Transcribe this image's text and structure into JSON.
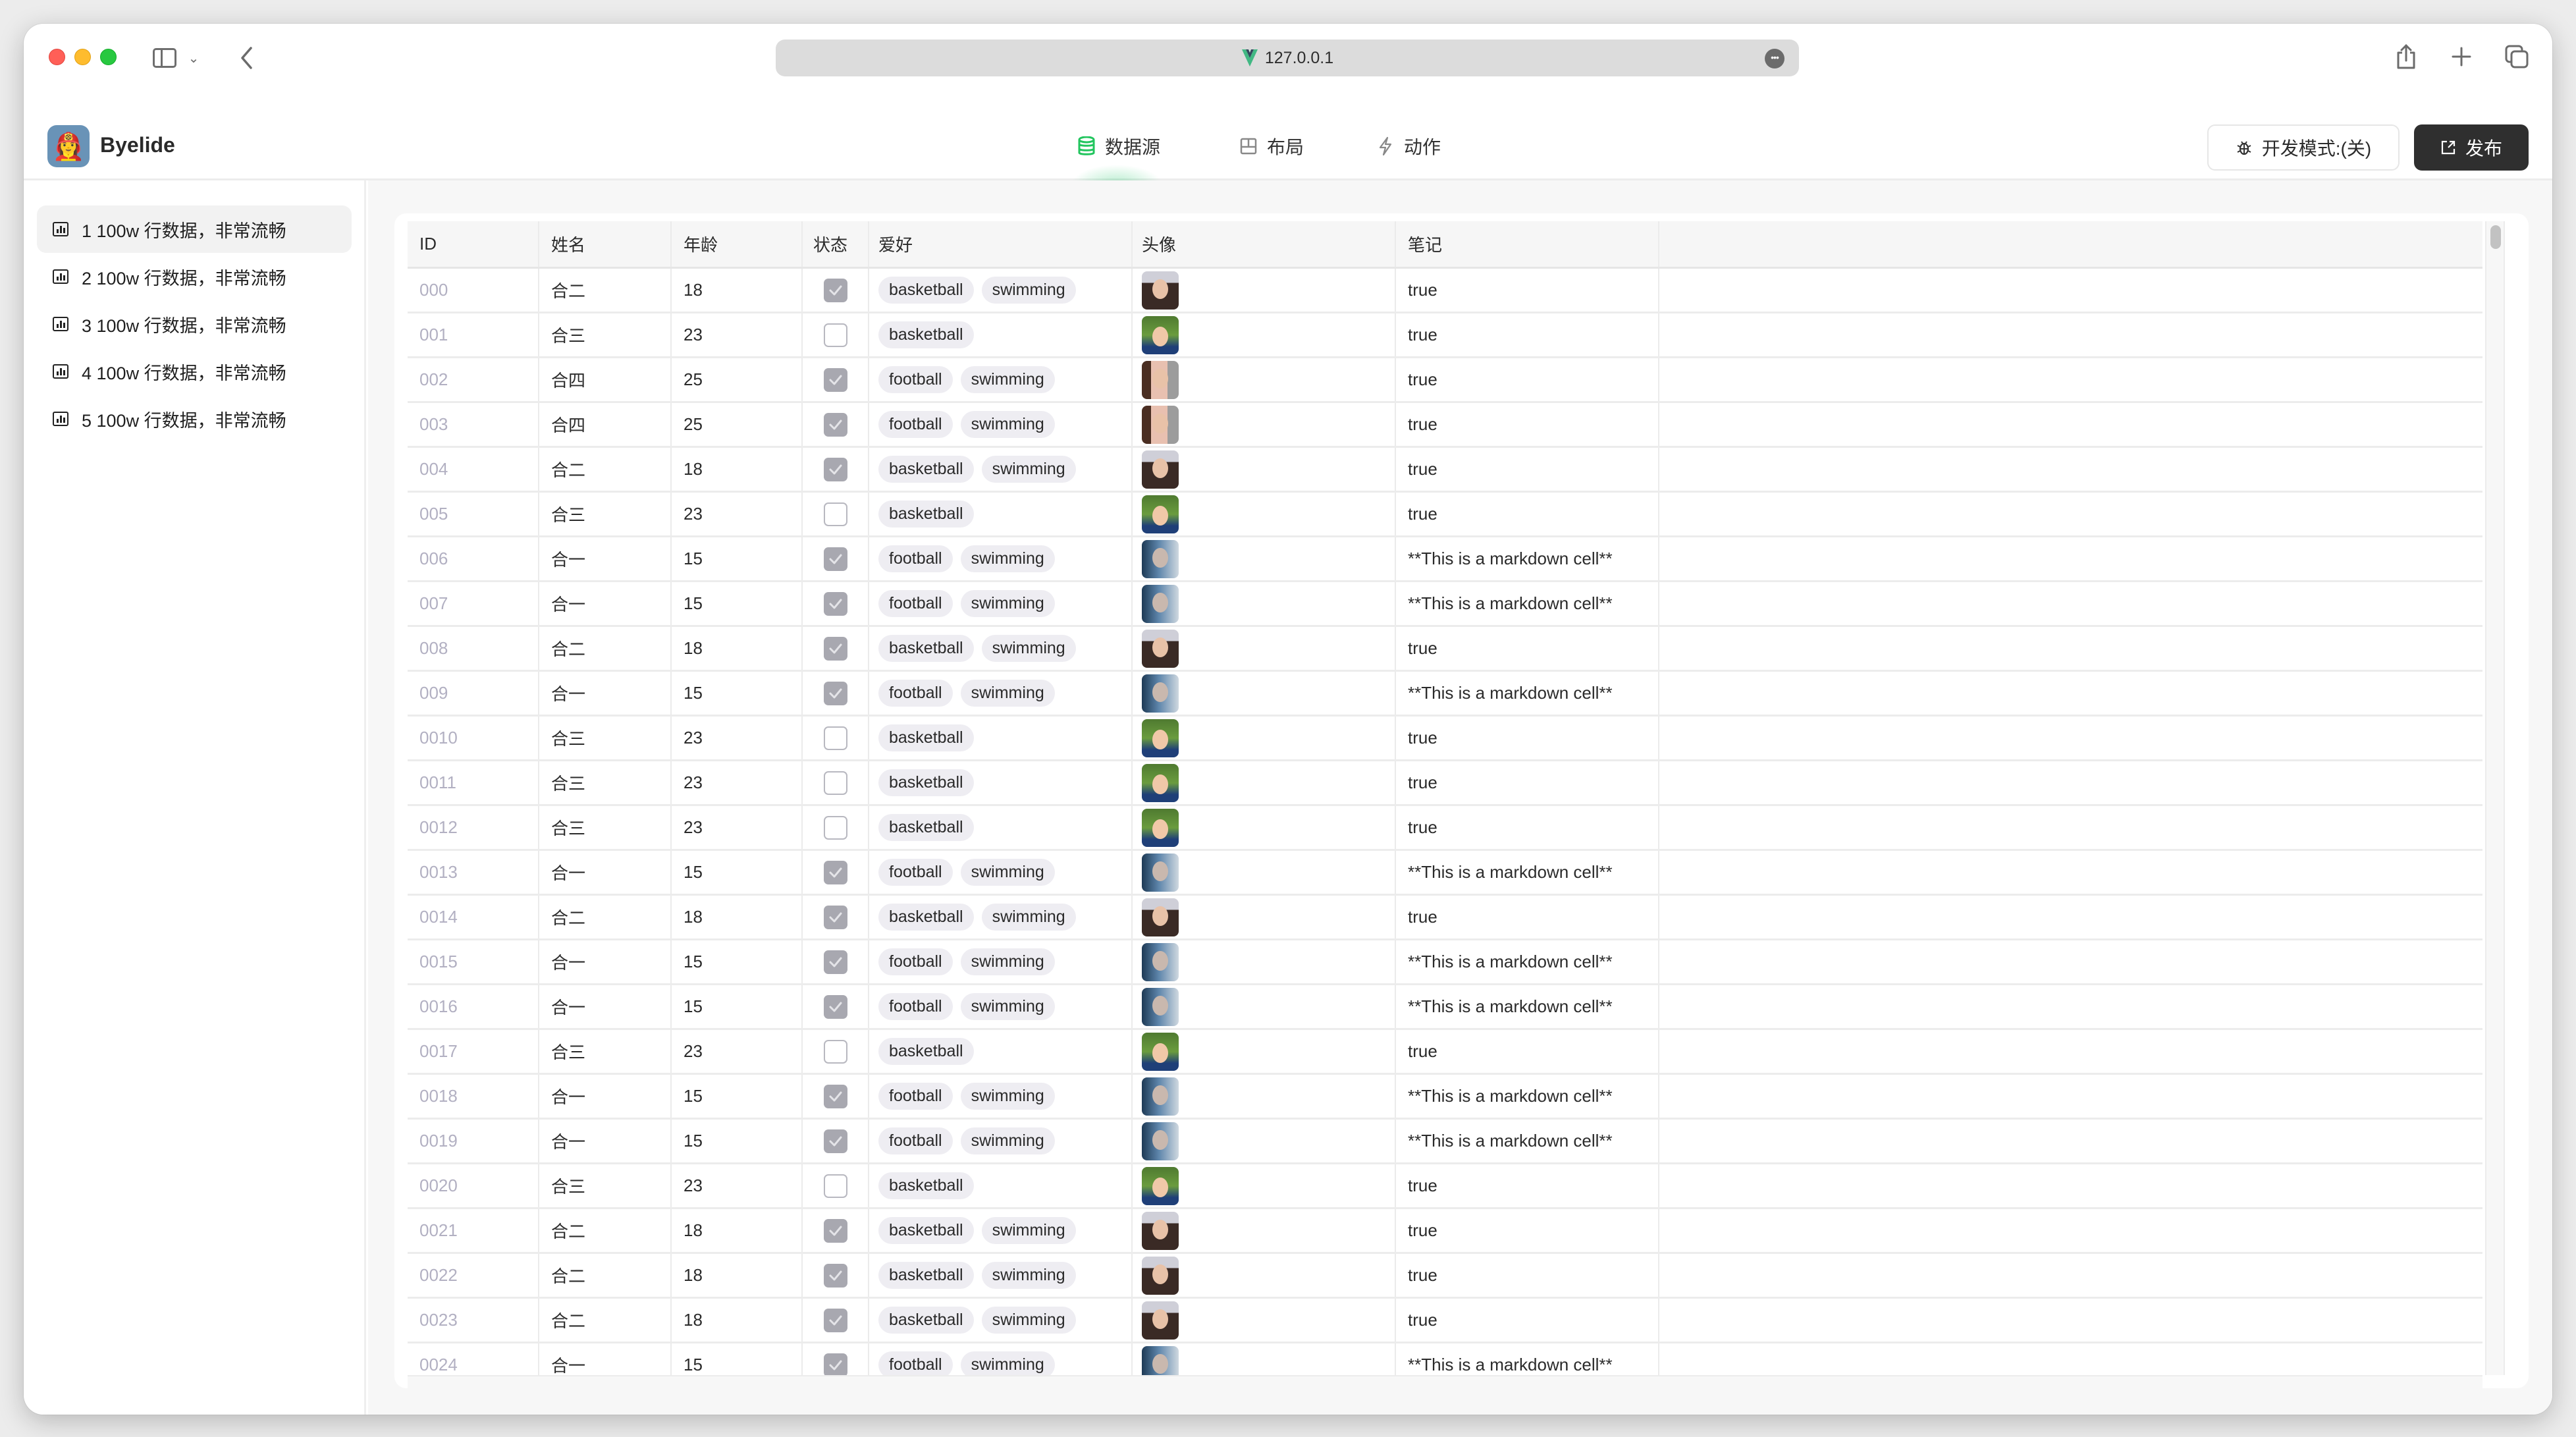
{
  "browser": {
    "url": "127.0.0.1",
    "url_icon": "vue-logo-icon",
    "more_icon": "ellipsis-icon",
    "toolbar_icons": [
      "share-icon",
      "new-tab-icon",
      "tabs-overview-icon"
    ]
  },
  "app": {
    "name": "Byelide",
    "logo_emoji": "👩‍🚒",
    "tabs": [
      {
        "label": "数据源",
        "icon": "database-icon",
        "active": true
      },
      {
        "label": "布局",
        "icon": "layout-icon",
        "active": false
      },
      {
        "label": "动作",
        "icon": "lightning-icon",
        "active": false
      }
    ],
    "dev_mode_label": "开发模式:(关)",
    "publish_label": "发布",
    "accent_color": "#22c55e"
  },
  "sidebar": {
    "items": [
      {
        "label": "1 100w 行数据，非常流畅",
        "active": true
      },
      {
        "label": "2 100w 行数据，非常流畅",
        "active": false
      },
      {
        "label": "3 100w 行数据，非常流畅",
        "active": false
      },
      {
        "label": "4 100w 行数据，非常流畅",
        "active": false
      },
      {
        "label": "5 100w 行数据，非常流畅",
        "active": false
      }
    ]
  },
  "table": {
    "columns": [
      "ID",
      "姓名",
      "年龄",
      "状态",
      "爱好",
      "头像",
      "笔记"
    ],
    "rows": [
      {
        "id": "000",
        "name": "合二",
        "age": "18",
        "status": true,
        "hobbies": [
          "basketball",
          "swimming"
        ],
        "avatar": "woman1",
        "note": "true"
      },
      {
        "id": "001",
        "name": "合三",
        "age": "23",
        "status": false,
        "hobbies": [
          "basketball"
        ],
        "avatar": "boy",
        "note": "true"
      },
      {
        "id": "002",
        "name": "合四",
        "age": "25",
        "status": true,
        "hobbies": [
          "football",
          "swimming"
        ],
        "avatar": "woman2",
        "note": "true"
      },
      {
        "id": "003",
        "name": "合四",
        "age": "25",
        "status": true,
        "hobbies": [
          "football",
          "swimming"
        ],
        "avatar": "woman2",
        "note": "true"
      },
      {
        "id": "004",
        "name": "合二",
        "age": "18",
        "status": true,
        "hobbies": [
          "basketball",
          "swimming"
        ],
        "avatar": "woman1",
        "note": "true"
      },
      {
        "id": "005",
        "name": "合三",
        "age": "23",
        "status": false,
        "hobbies": [
          "basketball"
        ],
        "avatar": "boy",
        "note": "true"
      },
      {
        "id": "006",
        "name": "合一",
        "age": "15",
        "status": true,
        "hobbies": [
          "football",
          "swimming"
        ],
        "avatar": "man",
        "note": "**This is a markdown cell**"
      },
      {
        "id": "007",
        "name": "合一",
        "age": "15",
        "status": true,
        "hobbies": [
          "football",
          "swimming"
        ],
        "avatar": "man",
        "note": "**This is a markdown cell**"
      },
      {
        "id": "008",
        "name": "合二",
        "age": "18",
        "status": true,
        "hobbies": [
          "basketball",
          "swimming"
        ],
        "avatar": "woman1",
        "note": "true"
      },
      {
        "id": "009",
        "name": "合一",
        "age": "15",
        "status": true,
        "hobbies": [
          "football",
          "swimming"
        ],
        "avatar": "man",
        "note": "**This is a markdown cell**"
      },
      {
        "id": "0010",
        "name": "合三",
        "age": "23",
        "status": false,
        "hobbies": [
          "basketball"
        ],
        "avatar": "boy",
        "note": "true"
      },
      {
        "id": "0011",
        "name": "合三",
        "age": "23",
        "status": false,
        "hobbies": [
          "basketball"
        ],
        "avatar": "boy",
        "note": "true"
      },
      {
        "id": "0012",
        "name": "合三",
        "age": "23",
        "status": false,
        "hobbies": [
          "basketball"
        ],
        "avatar": "boy",
        "note": "true"
      },
      {
        "id": "0013",
        "name": "合一",
        "age": "15",
        "status": true,
        "hobbies": [
          "football",
          "swimming"
        ],
        "avatar": "man",
        "note": "**This is a markdown cell**"
      },
      {
        "id": "0014",
        "name": "合二",
        "age": "18",
        "status": true,
        "hobbies": [
          "basketball",
          "swimming"
        ],
        "avatar": "woman1",
        "note": "true"
      },
      {
        "id": "0015",
        "name": "合一",
        "age": "15",
        "status": true,
        "hobbies": [
          "football",
          "swimming"
        ],
        "avatar": "man",
        "note": "**This is a markdown cell**"
      },
      {
        "id": "0016",
        "name": "合一",
        "age": "15",
        "status": true,
        "hobbies": [
          "football",
          "swimming"
        ],
        "avatar": "man",
        "note": "**This is a markdown cell**"
      },
      {
        "id": "0017",
        "name": "合三",
        "age": "23",
        "status": false,
        "hobbies": [
          "basketball"
        ],
        "avatar": "boy",
        "note": "true"
      },
      {
        "id": "0018",
        "name": "合一",
        "age": "15",
        "status": true,
        "hobbies": [
          "football",
          "swimming"
        ],
        "avatar": "man",
        "note": "**This is a markdown cell**"
      },
      {
        "id": "0019",
        "name": "合一",
        "age": "15",
        "status": true,
        "hobbies": [
          "football",
          "swimming"
        ],
        "avatar": "man",
        "note": "**This is a markdown cell**"
      },
      {
        "id": "0020",
        "name": "合三",
        "age": "23",
        "status": false,
        "hobbies": [
          "basketball"
        ],
        "avatar": "boy",
        "note": "true"
      },
      {
        "id": "0021",
        "name": "合二",
        "age": "18",
        "status": true,
        "hobbies": [
          "basketball",
          "swimming"
        ],
        "avatar": "woman1",
        "note": "true"
      },
      {
        "id": "0022",
        "name": "合二",
        "age": "18",
        "status": true,
        "hobbies": [
          "basketball",
          "swimming"
        ],
        "avatar": "woman1",
        "note": "true"
      },
      {
        "id": "0023",
        "name": "合二",
        "age": "18",
        "status": true,
        "hobbies": [
          "basketball",
          "swimming"
        ],
        "avatar": "woman1",
        "note": "true"
      },
      {
        "id": "0024",
        "name": "合一",
        "age": "15",
        "status": true,
        "hobbies": [
          "football",
          "swimming"
        ],
        "avatar": "man",
        "note": "**This is a markdown cell**"
      }
    ]
  }
}
